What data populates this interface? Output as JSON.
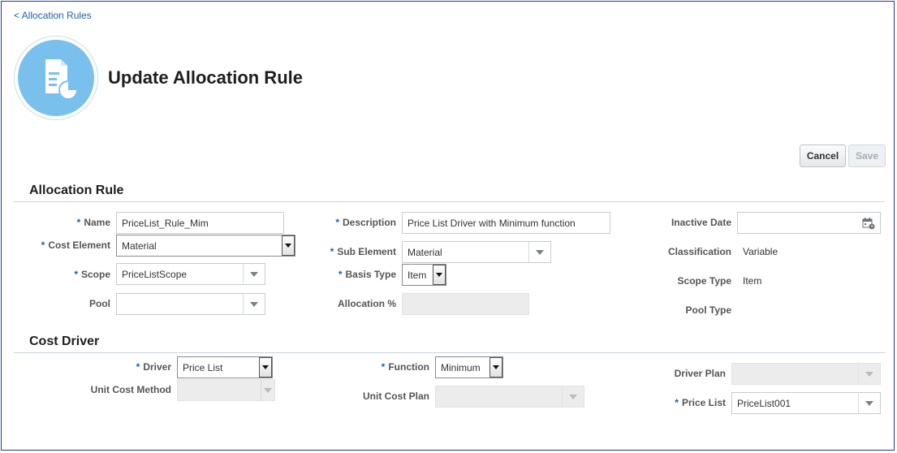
{
  "breadcrumb": {
    "back_link": "< Allocation Rules"
  },
  "page": {
    "title": "Update Allocation Rule",
    "icon": "document-chart-icon",
    "accent_color": "#79c0ec"
  },
  "toolbar": {
    "cancel_label": "Cancel",
    "save_label": "Save"
  },
  "allocation_rule": {
    "section_title": "Allocation Rule",
    "name": {
      "label": "Name",
      "value": "PriceList_Rule_Mim",
      "required": true
    },
    "cost_element": {
      "label": "Cost Element",
      "value": "Material",
      "required": true
    },
    "scope": {
      "label": "Scope",
      "value": "PriceListScope",
      "required": true
    },
    "pool": {
      "label": "Pool",
      "value": ""
    },
    "description": {
      "label": "Description",
      "value": "Price List Driver with Minimum function",
      "required": true
    },
    "sub_element": {
      "label": "Sub Element",
      "value": "Material",
      "required": true
    },
    "basis_type": {
      "label": "Basis Type",
      "value": "Item",
      "required": true
    },
    "allocation_pct": {
      "label": "Allocation %",
      "value": ""
    },
    "inactive_date": {
      "label": "Inactive Date",
      "value": "",
      "icon": "calendar-icon"
    },
    "classification": {
      "label": "Classification",
      "value": "Variable"
    },
    "scope_type": {
      "label": "Scope Type",
      "value": "Item"
    },
    "pool_type": {
      "label": "Pool Type",
      "value": ""
    }
  },
  "cost_driver": {
    "section_title": "Cost Driver",
    "driver": {
      "label": "Driver",
      "value": "Price List",
      "required": true
    },
    "unit_cost_method": {
      "label": "Unit Cost Method",
      "value": ""
    },
    "function": {
      "label": "Function",
      "value": "Minimum",
      "required": true
    },
    "unit_cost_plan": {
      "label": "Unit Cost Plan",
      "value": ""
    },
    "driver_plan": {
      "label": "Driver Plan",
      "value": ""
    },
    "price_list": {
      "label": "Price List",
      "value": "PriceList001",
      "required": true
    }
  }
}
